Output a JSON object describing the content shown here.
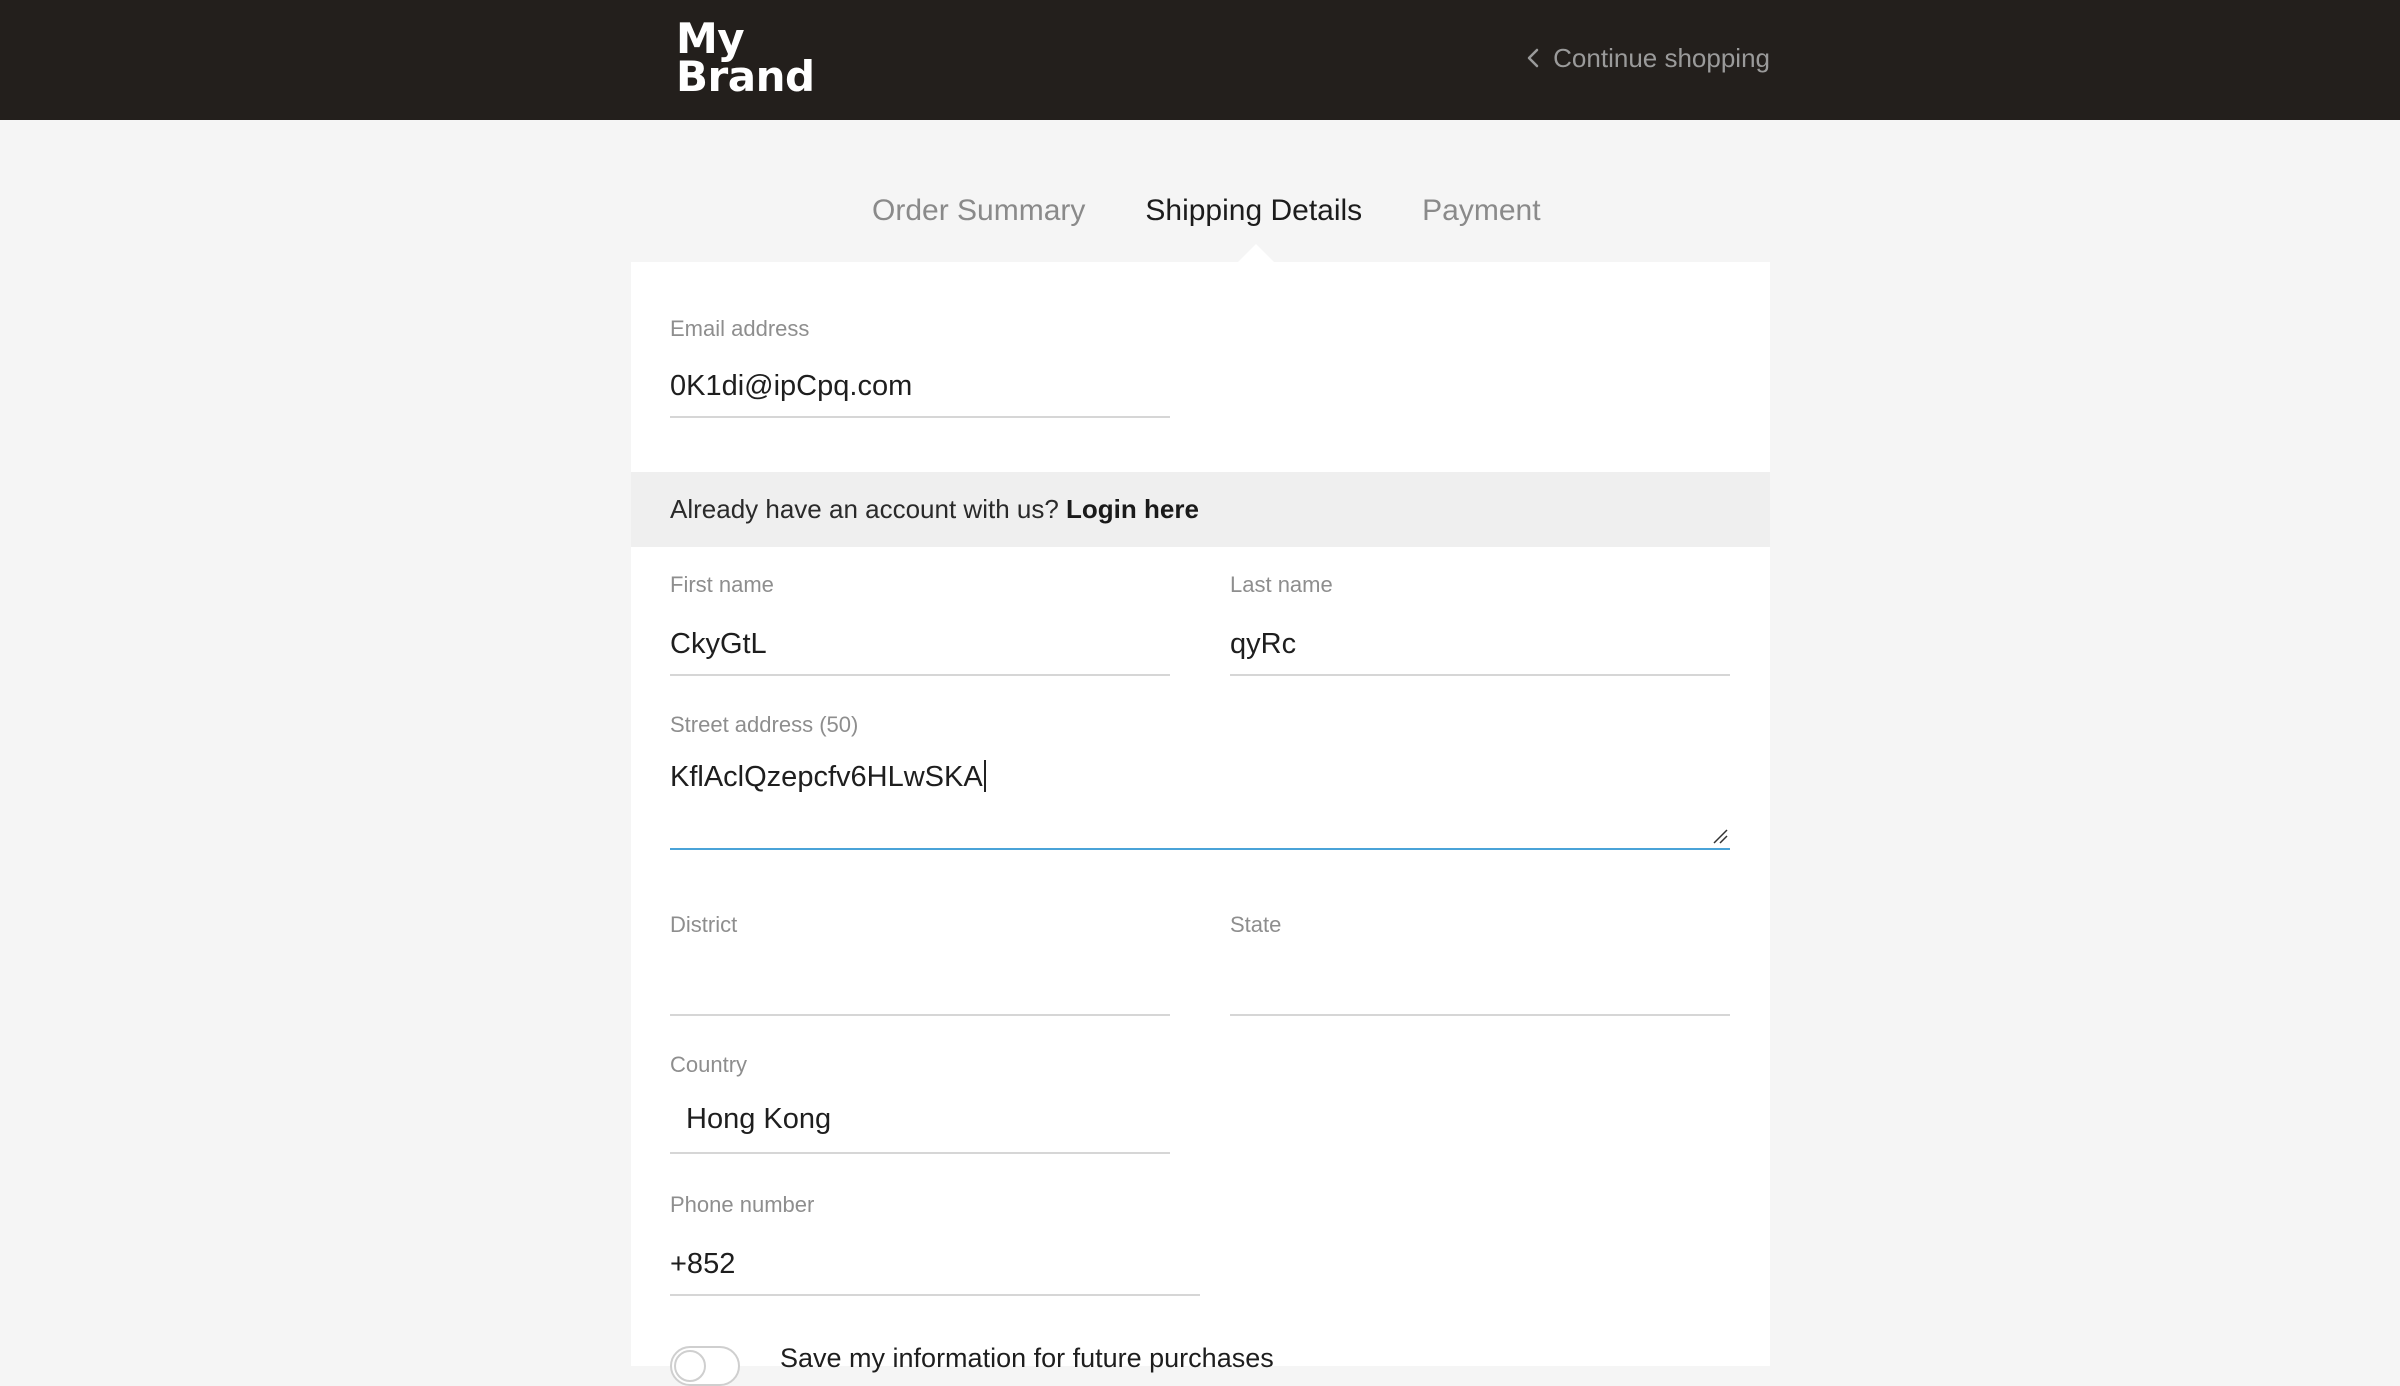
{
  "header": {
    "logo_line1": "My",
    "logo_line2": "Brand",
    "continue_label": "Continue shopping"
  },
  "steps": [
    {
      "label": "Order Summary",
      "active": false
    },
    {
      "label": "Shipping Details",
      "active": true
    },
    {
      "label": "Payment",
      "active": false
    }
  ],
  "form": {
    "email": {
      "label": "Email address",
      "value": "0K1di@ipCpq.com"
    },
    "login_prompt": "Already have an account with us?",
    "login_link": "Login here",
    "first_name": {
      "label": "First name",
      "value": "CkyGtL"
    },
    "last_name": {
      "label": "Last name",
      "value": "qyRc"
    },
    "street": {
      "label": "Street address (50)",
      "value": "KflAclQzepcfv6HLwSKA"
    },
    "district": {
      "label": "District",
      "value": ""
    },
    "state": {
      "label": "State",
      "value": ""
    },
    "country": {
      "label": "Country",
      "value": "Hong Kong"
    },
    "phone": {
      "label": "Phone number",
      "value": "+852"
    },
    "save_info_label": "Save my information for future purchases"
  },
  "colors": {
    "header_bg": "#231f1c",
    "focus_accent": "#4aa3d8"
  }
}
